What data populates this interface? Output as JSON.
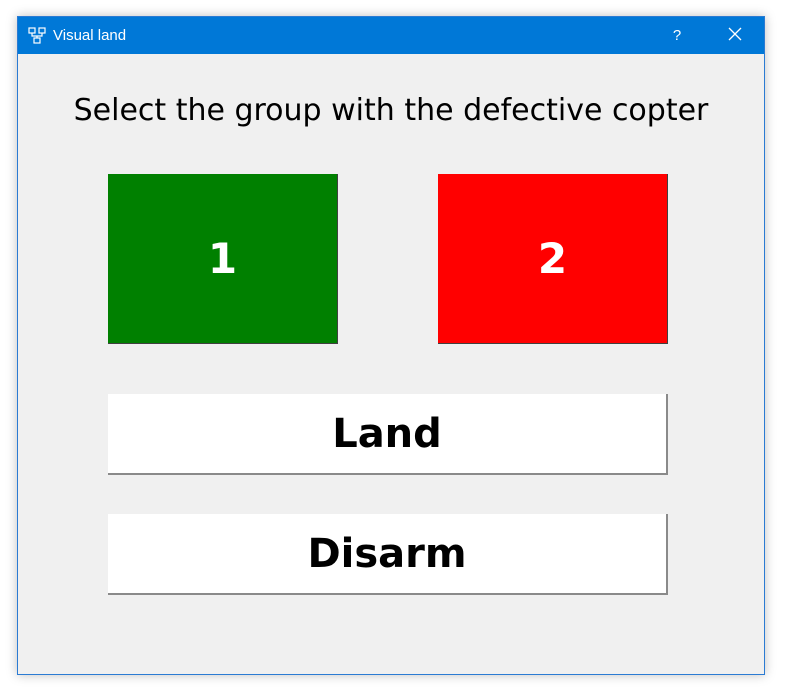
{
  "window": {
    "title": "Visual land",
    "help_label": "?",
    "icon": "app-network-icon",
    "close_icon": "close-icon"
  },
  "prompt": "Select the group with the defective copter",
  "groups": [
    {
      "label": "1",
      "color": "#008000"
    },
    {
      "label": "2",
      "color": "#ff0000"
    }
  ],
  "actions": {
    "land_label": "Land",
    "disarm_label": "Disarm"
  },
  "colors": {
    "titlebar": "#0078d7",
    "window_bg": "#f0f0f0"
  }
}
